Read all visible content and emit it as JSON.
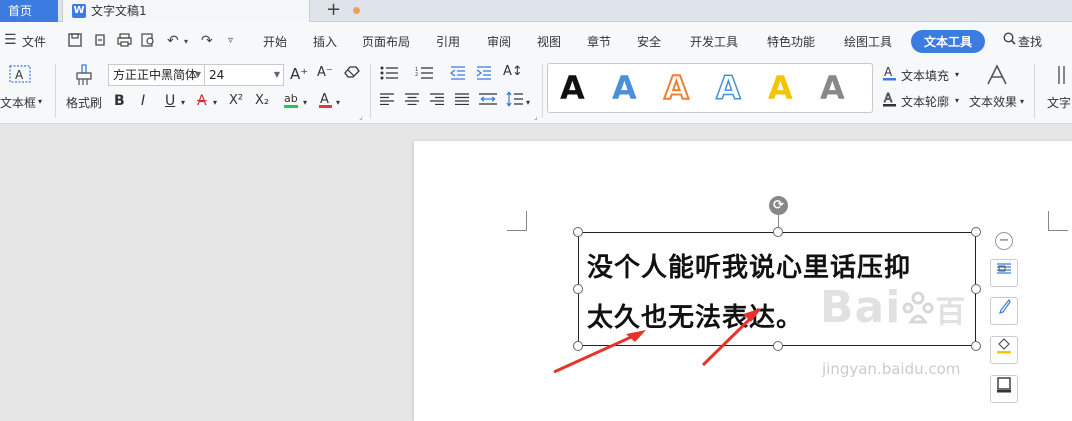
{
  "tabs": {
    "home": "首页",
    "document": "文字文稿1",
    "add": "+"
  },
  "menu": {
    "file": "文件",
    "items": [
      "开始",
      "插入",
      "页面布局",
      "引用",
      "审阅",
      "视图",
      "章节",
      "安全",
      "开发工具",
      "特色功能",
      "绘图工具",
      "文本工具"
    ],
    "search": "查找"
  },
  "ribbon": {
    "textbox_label": "文本框",
    "format_painter_label": "格式刷",
    "font_name": "方正正中黑简体",
    "font_size": "24",
    "text_fill_label": "文本填充",
    "text_outline_label": "文本轮廓",
    "text_effect_label": "文本效果",
    "text_direction_label": "文字",
    "bold": "B",
    "italic": "I",
    "underline": "U",
    "strike": "A",
    "superscript": "X²",
    "subscript": "X₂",
    "font_color": "A",
    "grow": "A⁺",
    "shrink": "A⁻",
    "style_letter": "A"
  },
  "wordart_colors": [
    "#111111",
    "#4a8fd9",
    "#f08030",
    "#4a8fd9",
    "#f5c400",
    "#888888"
  ],
  "textbox": {
    "line1": "没个人能听我说心里话压抑",
    "line2": "太久也无法表达。"
  },
  "watermark": {
    "brand": "Bai",
    "brand_suffix": "百",
    "url": "jingyan.baidu.com"
  },
  "colors": {
    "accent": "#3c7be0",
    "arrow": "#e8332a"
  }
}
